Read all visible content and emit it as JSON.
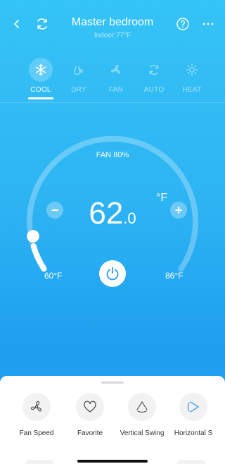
{
  "header": {
    "title": "Master bedroom",
    "subtitle": "Indoor:77°F",
    "icons": [
      "back-icon",
      "refresh-icon",
      "help-icon",
      "more-icon"
    ]
  },
  "modes": [
    {
      "label": "COOL",
      "icon": "snowflake-icon",
      "active": true
    },
    {
      "label": "DRY",
      "icon": "droplet-icon",
      "active": false
    },
    {
      "label": "FAN",
      "icon": "fan-icon",
      "active": false
    },
    {
      "label": "AUTO",
      "icon": "auto-icon",
      "active": false
    },
    {
      "label": "HEAT",
      "icon": "sun-icon",
      "active": false
    }
  ],
  "dial": {
    "fan_text": "FAN 80%",
    "temp_int": "62",
    "temp_dec": ".0",
    "unit": "°F",
    "minus": "−",
    "plus": "+",
    "min_label": "60°F",
    "max_label": "86°F"
  },
  "features": [
    {
      "label": "Fan Speed",
      "icon": "fan-speed-icon"
    },
    {
      "label": "Favorite",
      "icon": "heart-icon"
    },
    {
      "label": "Vertical Swing",
      "icon": "vertical-swing-icon"
    },
    {
      "label": "Horizontal S",
      "icon": "horizontal-swing-icon"
    }
  ],
  "colors": {
    "background_top": "#35c4f6",
    "background_bottom": "#1e9ff0",
    "accent": "#2196f3"
  }
}
